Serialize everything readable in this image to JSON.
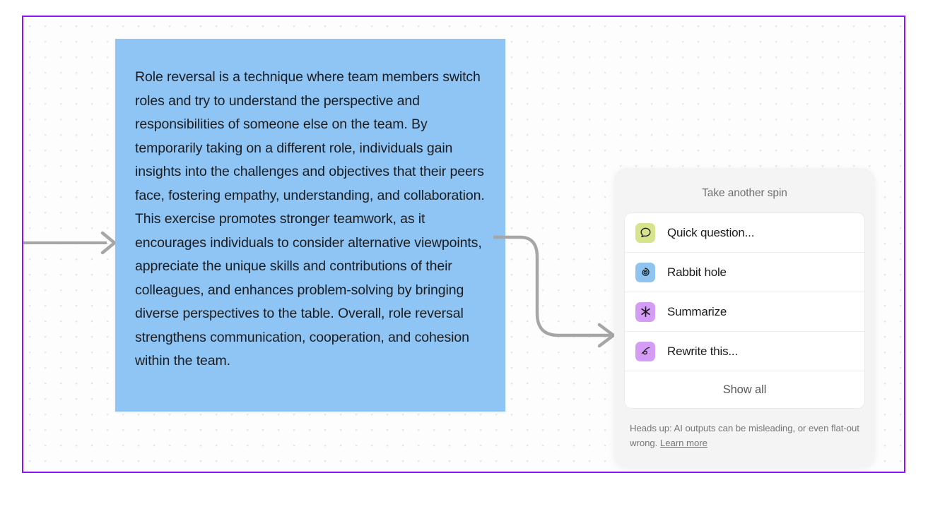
{
  "canvas": {
    "border_color": "#9013fe",
    "background": "#fdfdfd",
    "dot_color": "#e8e6ea"
  },
  "note_card": {
    "background_color": "#8ec5f5",
    "text": "Role reversal is a technique where team members switch roles and try to understand the perspective and responsibilities of someone else on the team. By temporarily taking on a different role, individuals gain insights into the challenges and objectives that their peers face, fostering empathy, understanding, and collaboration. This exercise promotes stronger teamwork, as it encourages individuals to consider alternative viewpoints, appreciate the unique skills and contributions of their colleagues, and enhances problem-solving by bringing diverse perspectives to the table. Overall, role reversal strengthens communication, cooperation, and cohesion within the team."
  },
  "connectors": {
    "incoming_arrow": "arrow-right",
    "outgoing_arrow": "arrow-curve-right",
    "stroke_color": "#a6a6a6",
    "endpoint_node": "circle-handle"
  },
  "spin_panel": {
    "title": "Take another spin",
    "background_color": "#f4f4f4",
    "items": [
      {
        "label": "Quick question...",
        "icon": "speech-bubble-icon",
        "icon_bg": "#d7e48b",
        "icon_name": "quick-question"
      },
      {
        "label": "Rabbit hole",
        "icon": "spiral-icon",
        "icon_bg": "#8fc4f0",
        "icon_name": "rabbit-hole"
      },
      {
        "label": "Summarize",
        "icon": "asterisk-sparkle-icon",
        "icon_bg": "#d49cf5",
        "icon_name": "summarize"
      },
      {
        "label": "Rewrite this...",
        "icon": "loop-squiggle-icon",
        "icon_bg": "#d49cf5",
        "icon_name": "rewrite-this"
      }
    ],
    "show_all_label": "Show all",
    "disclaimer": {
      "text": "Heads up: AI outputs can be misleading, or even flat-out wrong.",
      "link_label": "Learn more"
    }
  }
}
